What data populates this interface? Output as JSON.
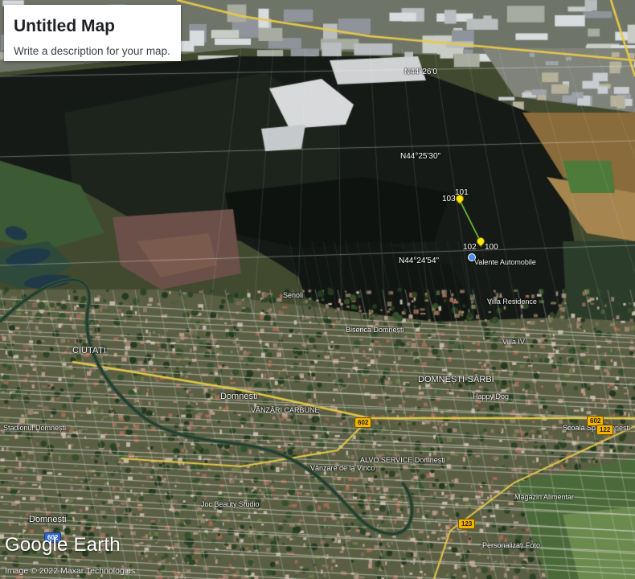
{
  "map": {
    "title": "Untitled Map",
    "description": "Write a description for your map.",
    "brand": "Google Earth",
    "attribution": "Image © 2022 Maxar Technologies",
    "coords": {
      "top": "N44°26'0",
      "upper": "N44°25'30\"",
      "lower": "N44°24'54\""
    },
    "pins": {
      "p100": "100",
      "p101": "101",
      "p102": "102",
      "p103": "103"
    },
    "places": {
      "valente": "Valente Automobile",
      "domnesti": "Domnești",
      "domnesti_sarbi": "DOMNEȘTI-SÂRBI",
      "ciorogarla": "CIUTAȚI",
      "senoli": "Senoli",
      "vanzari": "VÂNZĂRI CARBUNE",
      "alvo": "ALVO SERVICE Domnești",
      "magazin": "Magazin Alimentar",
      "personalizati": "Personalizați Foto",
      "happy": "Happy Dog",
      "scoala": "Școala Sp. Domnești",
      "ridicare": "Vânzare de la Vinco",
      "joc_beauty": "Joc Beauty Studio",
      "trans": "Villa Residence",
      "domnesti2": "Domnești",
      "stadion": "Stadionul Domnești",
      "villa_iv": "Villa IV",
      "biserica": "Biserica Domnești"
    },
    "roads": {
      "r1": "602",
      "r2": "602",
      "r3": "122",
      "r4": "123",
      "r5": "602"
    }
  }
}
